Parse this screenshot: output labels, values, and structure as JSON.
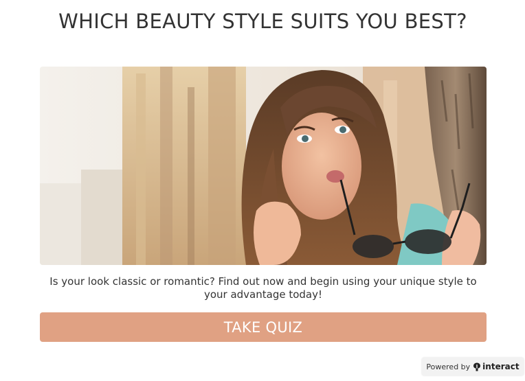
{
  "quiz": {
    "title": "WHICH BEAUTY STYLE SUITS YOU BEST?",
    "description": "Is your look classic or romantic? Find out now and begin using your unique style to your advantage today!",
    "cta_label": "TAKE QUIZ",
    "cover_image": "woman-with-sunglasses-photo"
  },
  "footer": {
    "powered_by": "Powered by",
    "brand": "interact",
    "brand_icon": "interact-logo-icon"
  },
  "colors": {
    "accent": "#e0a183",
    "title_text": "#333333",
    "background": "#ffffff"
  }
}
